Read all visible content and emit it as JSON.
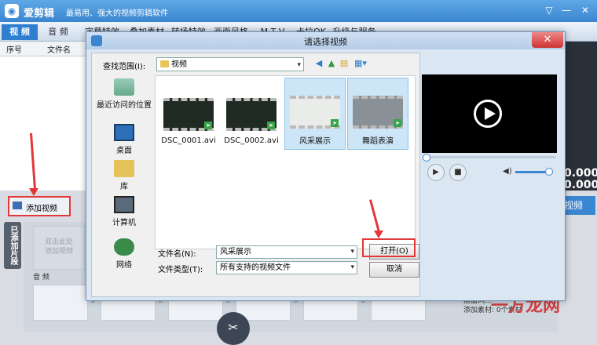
{
  "app": {
    "name": "爱剪辑",
    "slogan": "最易用、强大的视频剪辑软件",
    "logo_glyph": "◉",
    "window_buttons": [
      "▽",
      "—",
      "✕"
    ]
  },
  "tabs": [
    "视 频",
    "音 频",
    "字幕特效",
    "叠加素材",
    "转场特效",
    "画面风格",
    "M T V",
    "卡拉OK",
    "升级与服务"
  ],
  "list": {
    "columns": [
      "序号",
      "文件名"
    ]
  },
  "add_video_button": "添加视频",
  "side_tab": "已添加片段",
  "clip_zone": {
    "placeholder": "双击此处\n添加视频",
    "audio_label": "音 频",
    "cut_icon": "✂"
  },
  "right_panel": {
    "time1": "0.000",
    "time2": "0.000",
    "export_label": "视频"
  },
  "info_lines": [
    "画面风...",
    "添加素材:    0个素材"
  ],
  "watermark": "一方龙网",
  "dialog": {
    "title": "请选择视频",
    "close": "✕",
    "look_in_label": "查找范围(I):",
    "look_in_value": "视频",
    "nav_icons": [
      "back-icon",
      "up-icon",
      "new-folder-icon",
      "view-menu-icon"
    ],
    "places": [
      "最近访问的位置",
      "桌面",
      "库",
      "计算机",
      "网络"
    ],
    "files": [
      {
        "name": "DSC_0001.avi",
        "selected": false
      },
      {
        "name": "DSC_0002.avi",
        "selected": false
      },
      {
        "name": "风采展示",
        "selected": true
      },
      {
        "name": "舞蹈表演",
        "selected": true
      }
    ],
    "filename_label": "文件名(N):",
    "filename_value": "风采展示",
    "filetype_label": "文件类型(T):",
    "filetype_value": "所有支持的视频文件",
    "open_button": "打开(O)",
    "cancel_button": "取消"
  },
  "colors": {
    "accent": "#3a86d0",
    "highlight": "#e2383a",
    "selection": "#cde6f7"
  }
}
